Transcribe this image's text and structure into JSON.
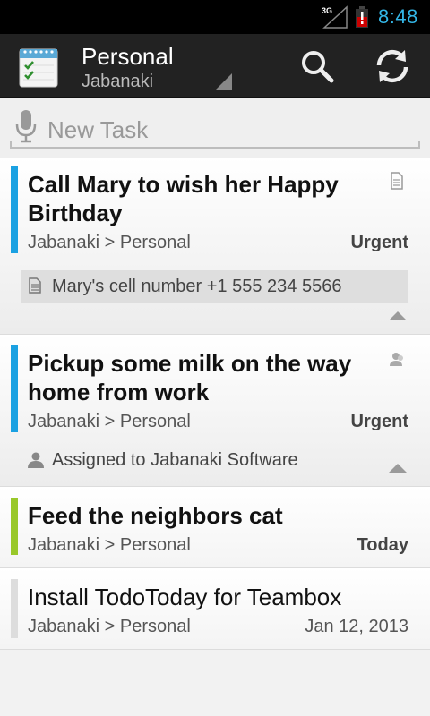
{
  "status_bar": {
    "network_label": "3G",
    "time": "8:48",
    "accent_color": "#33b5e5",
    "battery_color": "#cc0000"
  },
  "action_bar": {
    "title": "Personal",
    "subtitle": "Jabanaki",
    "icons": [
      "app-calendar-icon",
      "search-icon",
      "sync-icon"
    ]
  },
  "new_task": {
    "placeholder": "New Task",
    "icon": "mic-icon"
  },
  "tasks": [
    {
      "title": "Call Mary to wish her Happy Birthday",
      "path": "Jabanaki > Personal",
      "due": "Urgent",
      "color": "#1ba1e2",
      "note": "Mary's cell number +1 555 234 5566"
    },
    {
      "title": "Pickup some milk on the way home from work",
      "path": "Jabanaki > Personal",
      "due": "Urgent",
      "color": "#1ba1e2",
      "assignment": "Assigned to Jabanaki Software"
    },
    {
      "title": "Feed the neighbors cat",
      "path": "Jabanaki > Personal",
      "due": "Today",
      "color": "#99c82a"
    },
    {
      "title": "Install TodoToday for Teambox",
      "path": "Jabanaki > Personal",
      "due": "Jan 12, 2013",
      "color": "#dddddd"
    }
  ]
}
